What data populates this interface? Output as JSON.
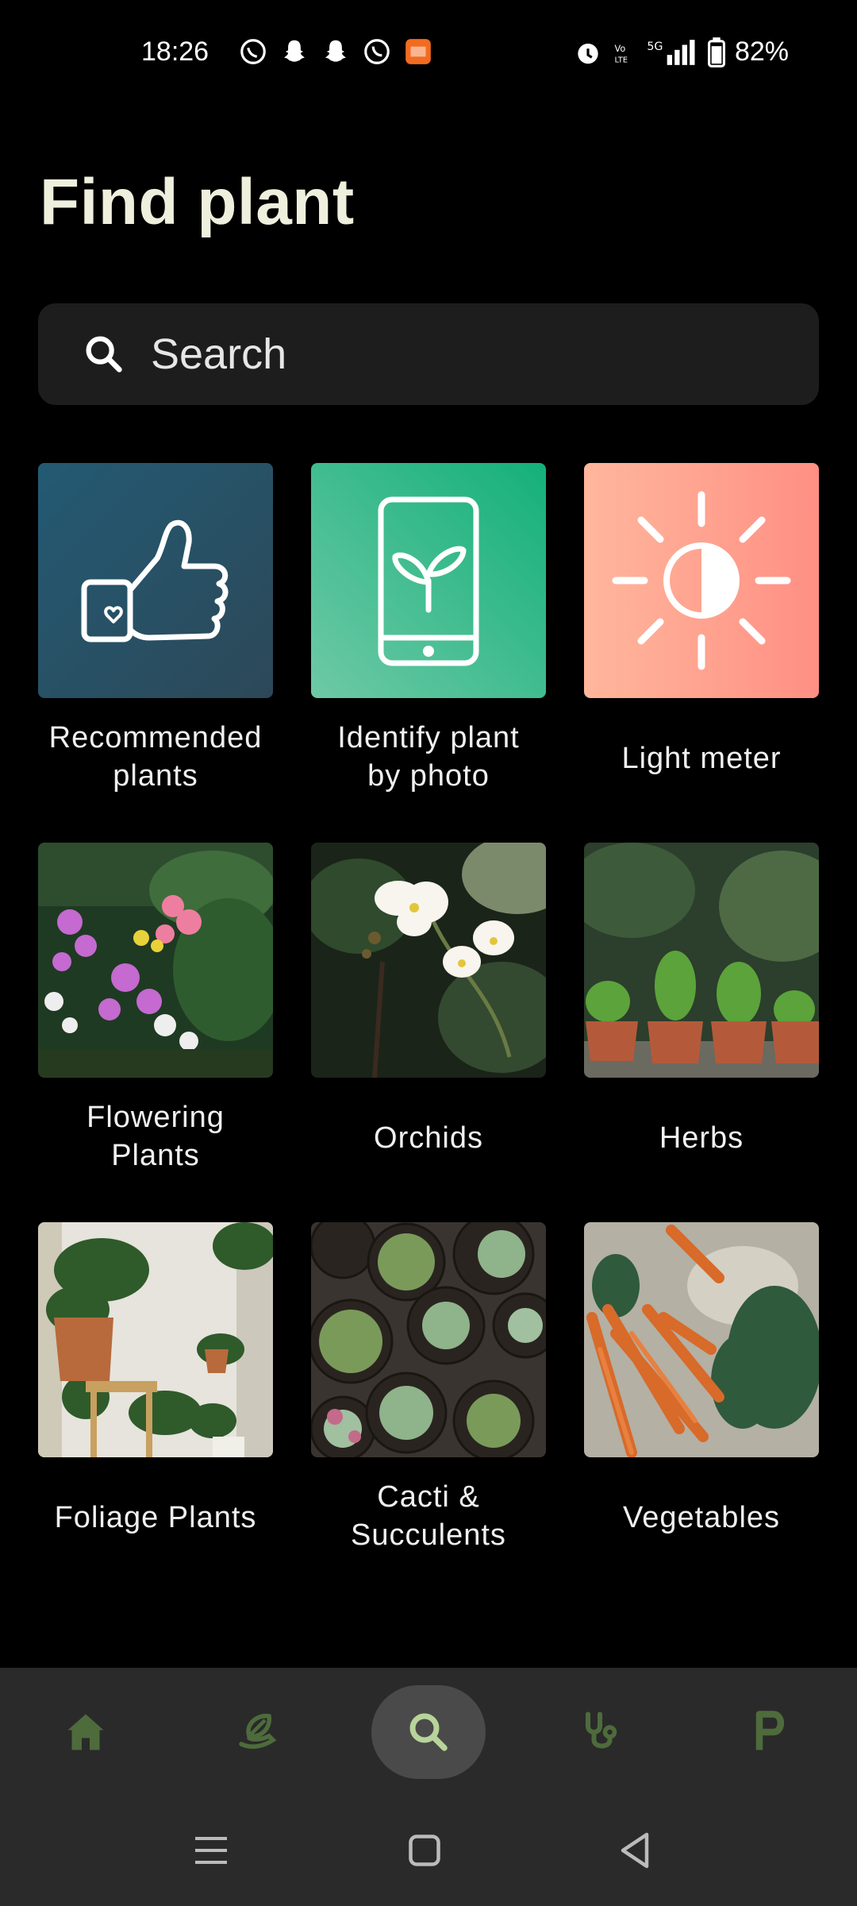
{
  "status_bar": {
    "time": "18:26",
    "battery": "82%",
    "network": "5G",
    "volte": "Vo LTE"
  },
  "page": {
    "title": "Find plant"
  },
  "search": {
    "placeholder": "Search"
  },
  "tiles": [
    {
      "label": "Recommended plants",
      "icon": "thumbs-up-icon"
    },
    {
      "label": "Identify plant by photo",
      "icon": "phone-sprout-icon"
    },
    {
      "label": "Light meter",
      "icon": "sun-icon"
    },
    {
      "label": "Flowering Plants",
      "icon": "flowering-plants-image"
    },
    {
      "label": "Orchids",
      "icon": "orchids-image"
    },
    {
      "label": "Herbs",
      "icon": "herbs-image"
    },
    {
      "label": "Foliage Plants",
      "icon": "foliage-plants-image"
    },
    {
      "label": "Cacti & Succulents",
      "icon": "cacti-succulents-image"
    },
    {
      "label": "Vegetables",
      "icon": "vegetables-image"
    }
  ],
  "bottom_nav": {
    "items": [
      {
        "name": "home",
        "icon": "home-icon"
      },
      {
        "name": "my-plants",
        "icon": "leaf-hand-icon"
      },
      {
        "name": "search",
        "icon": "search-icon",
        "active": true
      },
      {
        "name": "diagnose",
        "icon": "stethoscope-icon"
      },
      {
        "name": "premium",
        "icon": "letter-p-icon"
      }
    ]
  },
  "colors": {
    "background": "#000000",
    "title": "#eef0dd",
    "search_bg": "#1d1d1d",
    "nav_bg": "#2a2a2a",
    "nav_icon": "#4e6b3c",
    "nav_active_icon": "#b8d49a",
    "recommended_tile": "#2a5068",
    "identify_tile": "#3fbf8c",
    "light_tile": "#ff9e8a"
  }
}
